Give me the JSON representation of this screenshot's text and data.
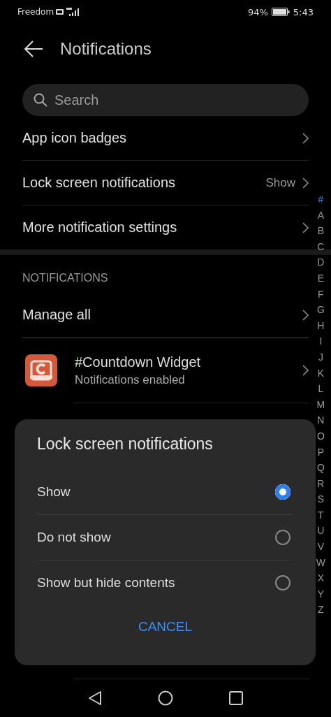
{
  "status_bar": {
    "carrier": "Freedom",
    "battery": "94%",
    "time": "5:43"
  },
  "header": {
    "title": "Notifications"
  },
  "search": {
    "placeholder": "Search"
  },
  "settings": [
    {
      "label": "App icon badges"
    },
    {
      "label": "Lock screen notifications",
      "value": "Show"
    },
    {
      "label": "More notification settings"
    }
  ],
  "section": {
    "title": "NOTIFICATIONS"
  },
  "manage": {
    "label": "Manage all"
  },
  "apps": [
    {
      "name": "#Countdown Widget",
      "status": "Notifications enabled"
    }
  ],
  "index": [
    {
      "letter": "#",
      "selected": true
    },
    {
      "letter": "A",
      "selected": false
    },
    {
      "letter": "B",
      "selected": false
    },
    {
      "letter": "C",
      "selected": false
    },
    {
      "letter": "D",
      "selected": false
    },
    {
      "letter": "E",
      "selected": false
    },
    {
      "letter": "F",
      "selected": false
    },
    {
      "letter": "G",
      "selected": false
    },
    {
      "letter": "H",
      "selected": false
    },
    {
      "letter": "I",
      "selected": false
    },
    {
      "letter": "J",
      "selected": false
    },
    {
      "letter": "K",
      "selected": false
    },
    {
      "letter": "L",
      "selected": false
    },
    {
      "letter": "M",
      "selected": false
    },
    {
      "letter": "N",
      "selected": false
    },
    {
      "letter": "O",
      "selected": false
    },
    {
      "letter": "P",
      "selected": false
    },
    {
      "letter": "Q",
      "selected": false
    },
    {
      "letter": "R",
      "selected": false
    },
    {
      "letter": "S",
      "selected": false
    },
    {
      "letter": "T",
      "selected": false
    },
    {
      "letter": "U",
      "selected": false
    },
    {
      "letter": "V",
      "selected": false
    },
    {
      "letter": "W",
      "selected": false
    },
    {
      "letter": "X",
      "selected": false
    },
    {
      "letter": "Y",
      "selected": false
    },
    {
      "letter": "Z",
      "selected": false
    }
  ],
  "dialog": {
    "title": "Lock screen notifications",
    "options": [
      {
        "label": "Show",
        "selected": true
      },
      {
        "label": "Do not show",
        "selected": false
      },
      {
        "label": "Show but hide contents",
        "selected": false
      }
    ],
    "cancel": "CANCEL"
  }
}
